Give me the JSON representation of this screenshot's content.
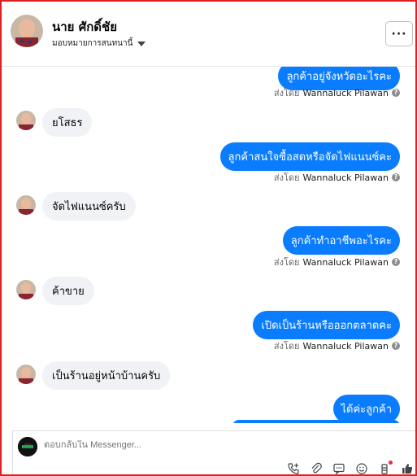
{
  "header": {
    "name": "นาย ศักดิ์ชัย",
    "assign_label": "มอบหมายการสนทนานี้",
    "more_label": "···"
  },
  "thread": {
    "outgoing": [
      {
        "text": "ลูกค้าอยู่จังหวัดอะไรคะ"
      },
      {
        "text": "ลูกค้าสนใจซื้อสดหรือจัดไฟแนนซ์คะ"
      },
      {
        "text": "ลูกค้าทำอาชีพอะไรคะ"
      },
      {
        "text": "เปิดเป็นร้านหรือออกตลาดคะ"
      },
      {
        "text": "ได้ค่ะลูกค้า"
      }
    ],
    "incoming": [
      {
        "text": "ยโสธร"
      },
      {
        "text": "จัดไฟแนนซ์ครับ"
      },
      {
        "text": "ค้าขาย"
      },
      {
        "text": "เป็นร้านอยู่หน้าบ้านครับ"
      }
    ],
    "sent_by_prefix": "ส่งโดย",
    "sent_by_name": "Wannaluck Pilawan"
  },
  "composer": {
    "placeholder": "ตอบกลับใน Messenger..."
  },
  "colors": {
    "accent": "#0a7cff",
    "incoming_bg": "#f0f2f5",
    "frame": "#e02020"
  },
  "icons": [
    "phone-plus-icon",
    "paperclip-icon",
    "chat-icon",
    "emoji-icon",
    "gift-icon",
    "thumbs-up-icon"
  ]
}
